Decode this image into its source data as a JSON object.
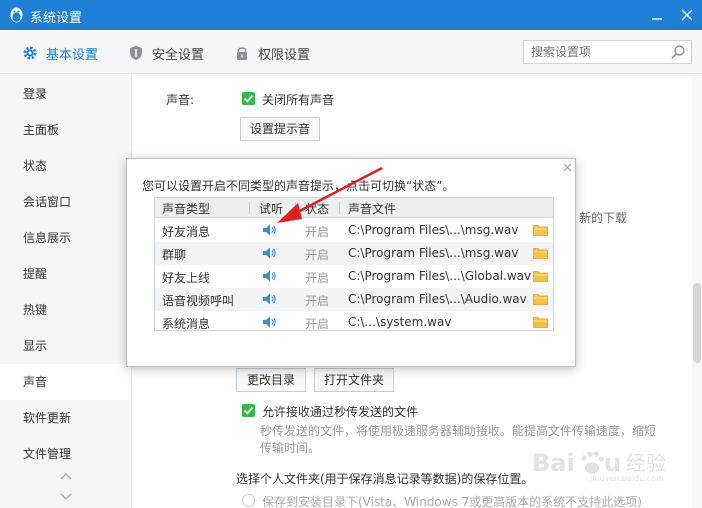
{
  "window": {
    "title": "系统设置"
  },
  "tabs": [
    {
      "label": "基本设置",
      "icon": "gear-icon",
      "active": true
    },
    {
      "label": "安全设置",
      "icon": "shield-icon",
      "active": false
    },
    {
      "label": "权限设置",
      "icon": "lock-icon",
      "active": false
    }
  ],
  "search": {
    "placeholder": "搜索设置项",
    "value": ""
  },
  "sidebar": {
    "items": [
      {
        "label": "登录"
      },
      {
        "label": "主面板"
      },
      {
        "label": "状态"
      },
      {
        "label": "会话窗口"
      },
      {
        "label": "信息展示"
      },
      {
        "label": "提醒"
      },
      {
        "label": "热键"
      },
      {
        "label": "显示"
      },
      {
        "label": "声音",
        "active": true
      },
      {
        "label": "软件更新"
      },
      {
        "label": "文件管理"
      }
    ]
  },
  "main": {
    "sound_label": "声音:",
    "mute_all_label": "关闭所有声音",
    "set_tone_button": "设置提示音",
    "behind_text": "新的下载",
    "change_dir_button": "更改目录",
    "open_folder_button": "打开文件夹",
    "allow_receive_label": "允许接收通过秒传发送的文件",
    "transfer_hint": "秒传发送的文件，将使用极速服务器辅助接收。能提高文件传输速度，缩短传输时间。",
    "folder_section_label": "选择个人文件夹(用于保存消息记录等数据)的保存位置。",
    "save_install_dir_option": "保存到安装目录下(Vista、Windows 7或更高版本的系统不支持此选项)"
  },
  "dialog": {
    "description": "您可以设置开启不同类型的声音提示，点击可切换“状态”。",
    "columns": [
      "声音类型",
      "试听",
      "状态",
      "声音文件"
    ],
    "rows": [
      {
        "type": "好友消息",
        "status": "开启",
        "file": "C:\\Program Files\\...\\msg.wav"
      },
      {
        "type": "群聊",
        "status": "开启",
        "file": "C:\\Program Files\\...\\msg.wav"
      },
      {
        "type": "好友上线",
        "status": "开启",
        "file": "C:\\Program Files\\...\\Global.wav"
      },
      {
        "type": "语音视频呼叫",
        "status": "开启",
        "file": "C:\\Program Files\\...\\Audio.wav"
      },
      {
        "type": "系统消息",
        "status": "开启",
        "file": "C:\\...\\system.wav"
      }
    ]
  },
  "colors": {
    "accent": "#1d7fd6",
    "check": "#36b94a",
    "arrow": "#e02020",
    "folder": "#f5c242"
  }
}
